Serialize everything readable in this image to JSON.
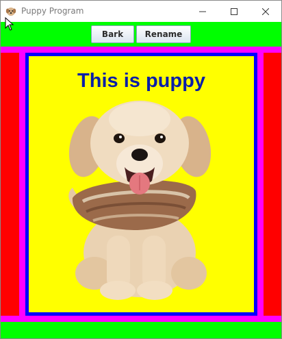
{
  "window": {
    "title": "Puppy Program",
    "icon": "puppy-app-icon"
  },
  "window_controls": {
    "minimize_icon": "minimize-icon",
    "maximize_icon": "maximize-icon",
    "close_icon": "close-icon"
  },
  "toolbar": {
    "bark_label": "Bark",
    "rename_label": "Rename"
  },
  "panel": {
    "title": "This is puppy",
    "image": "puppy-photo"
  },
  "colors": {
    "toolbar_bg": "#00ff00",
    "outer_border": "#ff00ff",
    "side_bars": "#ff0000",
    "panel_border": "#0000ff",
    "panel_bg": "#ffff00",
    "title_text": "#0a1ea8"
  }
}
